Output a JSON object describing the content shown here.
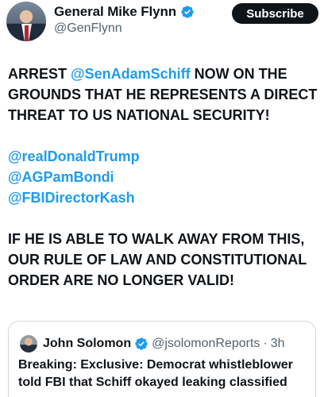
{
  "author": {
    "display_name": "General Mike Flynn",
    "handle": "@GenFlynn"
  },
  "actions": {
    "subscribe_label": "Subscribe"
  },
  "tweet": {
    "para1_prefix": "ARREST ",
    "para1_mention": "@SenAdamSchiff",
    "para1_suffix": " NOW ON THE GROUNDS THAT HE REPRESENTS A DIRECT THREAT TO US NATIONAL SECURITY!",
    "mentions": [
      "@realDonaldTrump",
      "@AGPamBondi",
      "@FBIDirectorKash"
    ],
    "para3": "IF HE IS ABLE TO WALK AWAY FROM THIS, OUR RULE OF LAW AND CONSTITUTIONAL ORDER ARE NO LONGER VALID!"
  },
  "quoted_tweet": {
    "display_name": "John Solomon",
    "handle": "@jsolomonReports",
    "separator": "·",
    "time": "3h",
    "text": "Breaking: Exclusive: Democrat whistleblower told FBI that Schiff okayed leaking classified"
  },
  "colors": {
    "verified": "#1d9bf0",
    "mention": "#1d9bf0",
    "subscribe_bg": "#0f1419"
  },
  "icons": {
    "verified": "verified-badge-icon"
  }
}
